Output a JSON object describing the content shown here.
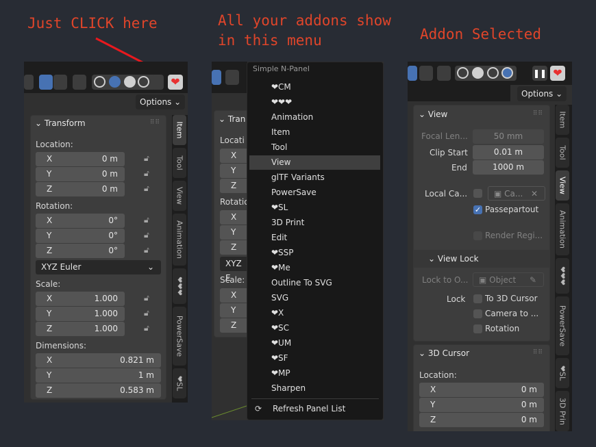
{
  "captions": {
    "click": "Just CLICK here",
    "menu": "All your addons show\nin this menu",
    "selected": "Addon Selected"
  },
  "colors": {
    "caption": "#e0452a",
    "accent": "#4772b3",
    "heart": "#e83030",
    "bg": "#282c34"
  },
  "panel1": {
    "options_label": "Options ⌄",
    "transform_title": "Transform",
    "location_label": "Location:",
    "location": [
      {
        "axis": "X",
        "value": "0 m"
      },
      {
        "axis": "Y",
        "value": "0 m"
      },
      {
        "axis": "Z",
        "value": "0 m"
      }
    ],
    "rotation_label": "Rotation:",
    "rotation": [
      {
        "axis": "X",
        "value": "0°"
      },
      {
        "axis": "Y",
        "value": "0°"
      },
      {
        "axis": "Z",
        "value": "0°"
      }
    ],
    "rotation_mode": "XYZ Euler",
    "scale_label": "Scale:",
    "scale": [
      {
        "axis": "X",
        "value": "1.000"
      },
      {
        "axis": "Y",
        "value": "1.000"
      },
      {
        "axis": "Z",
        "value": "1.000"
      }
    ],
    "dimensions_label": "Dimensions:",
    "dimensions": [
      {
        "axis": "X",
        "value": "0.821 m"
      },
      {
        "axis": "Y",
        "value": "1 m"
      },
      {
        "axis": "Z",
        "value": "0.583 m"
      }
    ],
    "tabs": [
      "Item",
      "Tool",
      "View",
      "Animation",
      "❤❤❤",
      "PowerSave",
      "❤SL"
    ]
  },
  "panel2": {
    "behind": {
      "transform_title": "Tran",
      "location_label": "Locati",
      "rotation_label": "Rotatio",
      "rotation_mode": "XYZ E",
      "scale_label": "Scale:",
      "axes": [
        "X",
        "Y",
        "Z"
      ]
    },
    "menu_title": "Simple N-Panel",
    "items": [
      "❤CM",
      "❤❤❤",
      "Animation",
      "Item",
      "Tool",
      "View",
      "glTF Variants",
      "PowerSave",
      "❤SL",
      "3D Print",
      "Edit",
      "❤SSP",
      "❤Me",
      "Outline To SVG",
      "SVG",
      "❤X",
      "❤SC",
      "❤UM",
      "❤SF",
      "❤MP",
      "Sharpen"
    ],
    "selected_index": 5,
    "refresh_label": "Refresh Panel List"
  },
  "panel3": {
    "options_label": "Options ⌄",
    "view_title": "View",
    "focal_label": "Focal Len...",
    "focal_value": "50 mm",
    "clip_start_label": "Clip Start",
    "clip_start_value": "0.01 m",
    "end_label": "End",
    "end_value": "1000 m",
    "local_camera_label": "Local Ca...",
    "local_camera_value": "Ca...",
    "passepartout_label": "Passepartout",
    "render_region_label": "Render Regi...",
    "view_lock_title": "View Lock",
    "lock_to_object_label": "Lock to O...",
    "lock_to_object_value": "Object",
    "lock_label": "Lock",
    "lock_3d_cursor": "To 3D Cursor",
    "lock_camera": "Camera to ...",
    "lock_rotation": "Rotation",
    "cursor_title": "3D Cursor",
    "cursor_location_label": "Location:",
    "cursor_location": [
      {
        "axis": "X",
        "value": "0 m"
      },
      {
        "axis": "Y",
        "value": "0 m"
      },
      {
        "axis": "Z",
        "value": "0 m"
      }
    ],
    "tabs": [
      "Item",
      "Tool",
      "View",
      "Animation",
      "❤❤❤",
      "PowerSave",
      "❤SL",
      "3D Prin"
    ]
  }
}
